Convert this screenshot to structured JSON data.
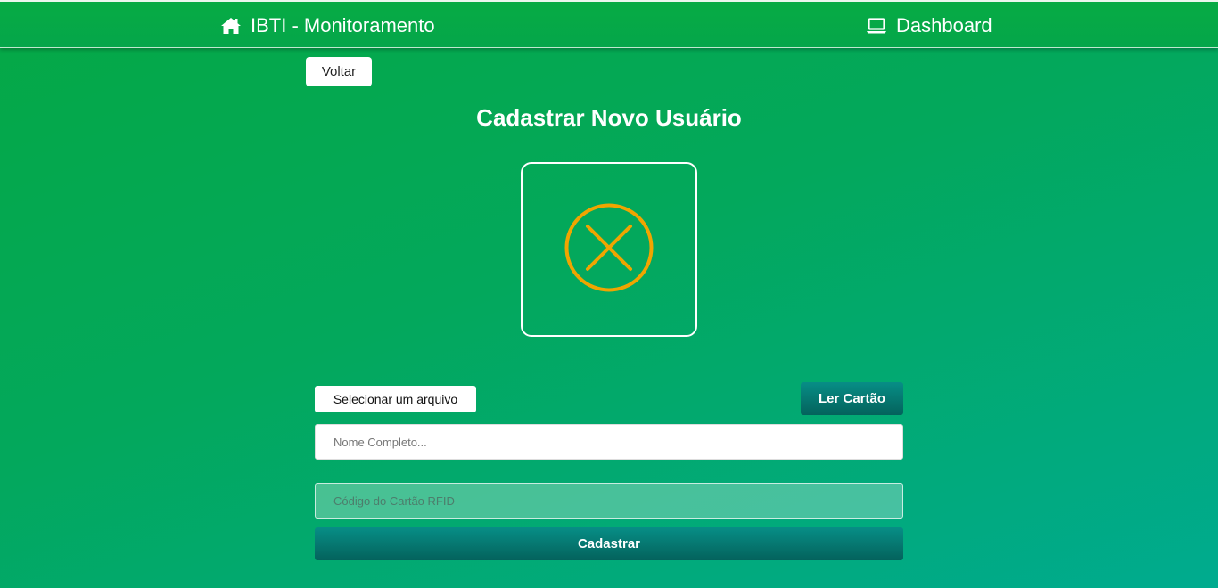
{
  "nav": {
    "brand_label": "IBTI - Monitoramento",
    "brand_icon": "home-icon",
    "dashboard_label": "Dashboard",
    "dashboard_icon": "laptop-icon"
  },
  "back_label": "Voltar",
  "page_title": "Cadastrar Novo Usuário",
  "photo": {
    "status_icon": "x-circle-icon",
    "status_color": "#f0a500"
  },
  "form": {
    "file_button_label": "Selecionar um arquivo",
    "read_card_label": "Ler Cartão",
    "name_placeholder": "Nome Completo...",
    "name_value": "",
    "rfid_placeholder": "Código do Cartão RFID",
    "rfid_value": "",
    "submit_label": "Cadastrar"
  },
  "colors": {
    "accent_start": "#05a845",
    "accent_end": "#00ab8f",
    "button_teal": "#078e86"
  }
}
